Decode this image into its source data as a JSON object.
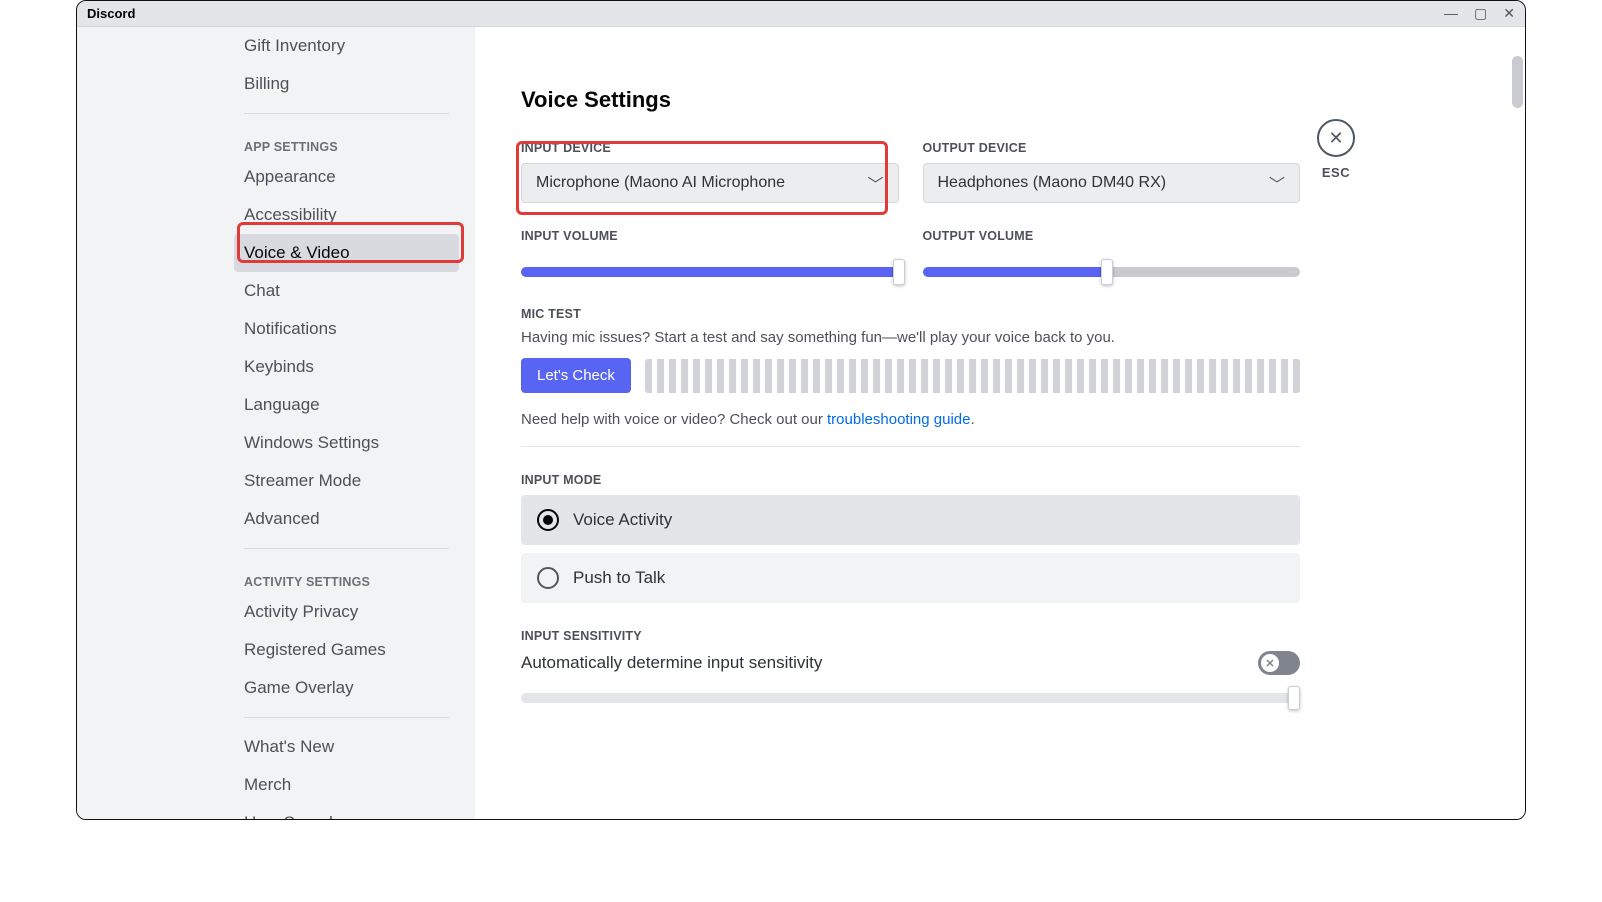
{
  "titlebar": {
    "app": "Discord"
  },
  "sidebar": {
    "items_top": [
      "Gift Inventory",
      "Billing"
    ],
    "header_app": "APP SETTINGS",
    "items_app": [
      "Appearance",
      "Accessibility",
      "Voice & Video",
      "Chat",
      "Notifications",
      "Keybinds",
      "Language",
      "Windows Settings",
      "Streamer Mode",
      "Advanced"
    ],
    "active_app_index": 2,
    "header_activity": "ACTIVITY SETTINGS",
    "items_activity": [
      "Activity Privacy",
      "Registered Games",
      "Game Overlay"
    ],
    "items_bottom": [
      "What's New",
      "Merch",
      "HypeSquad"
    ]
  },
  "close": {
    "esc": "ESC"
  },
  "page": {
    "title": "Voice Settings",
    "input_device_label": "INPUT DEVICE",
    "input_device_value": "Microphone (Maono AI Microphone",
    "output_device_label": "OUTPUT DEVICE",
    "output_device_value": "Headphones (Maono DM40 RX)",
    "input_volume_label": "INPUT VOLUME",
    "input_volume_pct": 100,
    "output_volume_label": "OUTPUT VOLUME",
    "output_volume_pct": 49,
    "mic_test_label": "MIC TEST",
    "mic_test_desc": "Having mic issues? Start a test and say something fun—we'll play your voice back to you.",
    "lets_check": "Let's Check",
    "help_prefix": "Need help with voice or video? Check out our ",
    "help_link": "troubleshooting guide",
    "help_suffix": ".",
    "input_mode_label": "INPUT MODE",
    "radio_voice": "Voice Activity",
    "radio_ptt": "Push to Talk",
    "input_sens_label": "INPUT SENSITIVITY",
    "auto_sens": "Automatically determine input sensitivity"
  }
}
